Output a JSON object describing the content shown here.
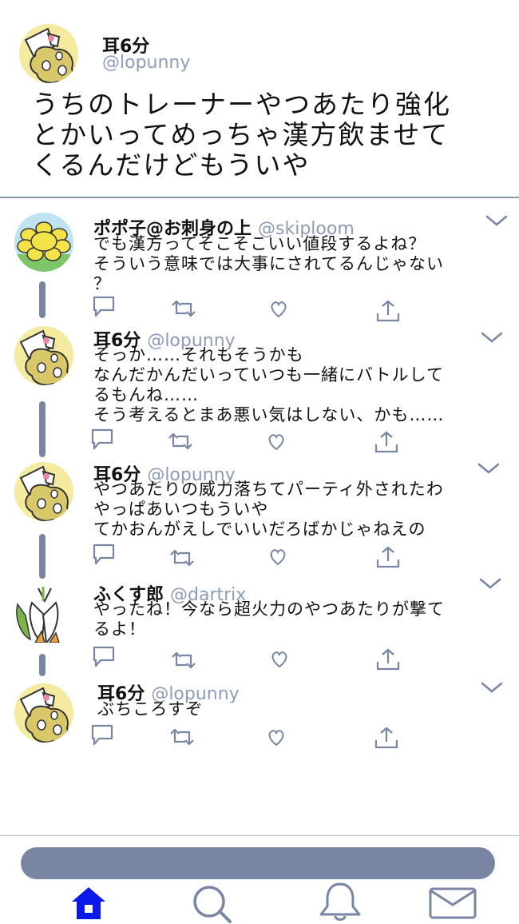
{
  "main_tweet": {
    "name": "耳6分",
    "handle": "@lopunny",
    "text": "うちのトレーナーやつあたり強化\nとかいってめっちゃ漢方飲ませて\nくるんだけどもういや"
  },
  "replies": [
    {
      "name": "ポポ子@お刺身の上",
      "handle": "@skiploom",
      "text": "でも漢方ってそこそこいい値段するよね？\nそういう意味では大事にされてるんじゃない\n？",
      "avatar": "sun-flower"
    },
    {
      "name": "耳6分",
      "handle": "@lopunny",
      "text": "そっか……それもそうかも\nなんだかんだいっていつも一緒にバトルして\nるもんね……\nそう考えるとまあ悪い気はしない、かも……",
      "avatar": "lopunny"
    },
    {
      "name": "耳6分",
      "handle": "@lopunny",
      "text": "やつあたりの威力落ちてパーティ外されたわ\nやっぱあいつもういや\nてかおんがえしでいいだろばかじゃねえの",
      "avatar": "lopunny"
    },
    {
      "name": "ふくす郎",
      "handle": "@dartrix",
      "text": "やったね！今なら超火力のやつあたりが撃て\nるよ！",
      "avatar": "dartrix"
    },
    {
      "name": "耳6分",
      "handle": "@lopunny",
      "text": "ぶちころすぞ",
      "avatar": "lopunny"
    }
  ],
  "icons": {
    "reply": "reply-icon",
    "retweet": "retweet-icon",
    "like": "heart-icon",
    "share": "share-icon",
    "expand": "chevron-down-icon"
  },
  "nav": {
    "items": [
      "home-icon",
      "search-icon",
      "bell-icon",
      "mail-icon"
    ],
    "active": "home-icon"
  },
  "colors": {
    "accent": "#8d9cb5",
    "thread_line": "#7886a4",
    "nav_active": "#0a18e8",
    "tweet_bar": "#7886a4"
  }
}
